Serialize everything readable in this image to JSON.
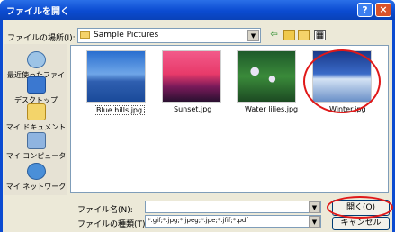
{
  "window": {
    "title": "ファイルを開く",
    "help": "?",
    "close": "×"
  },
  "toolbar": {
    "lookin_label": "ファイルの場所(I):",
    "lookin_value": "Sample Pictures",
    "arrow": "▼",
    "back": "⇦",
    "up": "",
    "newfolder": "",
    "view": "▦"
  },
  "places": [
    {
      "label": "最近使ったファイル",
      "icon": "recent-icon"
    },
    {
      "label": "デスクトップ",
      "icon": "desktop-icon"
    },
    {
      "label": "マイ ドキュメント",
      "icon": "my-documents-icon"
    },
    {
      "label": "マイ コンピュータ",
      "icon": "my-computer-icon"
    },
    {
      "label": "マイ ネットワーク",
      "icon": "my-network-icon"
    }
  ],
  "files": [
    {
      "name": "Blue hills.jpg"
    },
    {
      "name": "Sunset.jpg"
    },
    {
      "name": "Water lilies.jpg"
    },
    {
      "name": "Winter.jpg"
    }
  ],
  "bottom": {
    "filename_label": "ファイル名(N):",
    "filename_value": "",
    "filetype_label": "ファイルの種類(T):",
    "filetype_value": "*.gif;*.jpg;*.jpeg;*.jpe;*.jfif;*.pdf",
    "open_label": "開く(O)",
    "cancel_label": "キャンセル"
  },
  "colors": {
    "titlebar": "#0b4bd1",
    "dialog": "#ece9d8",
    "annotation": "#e01818"
  }
}
